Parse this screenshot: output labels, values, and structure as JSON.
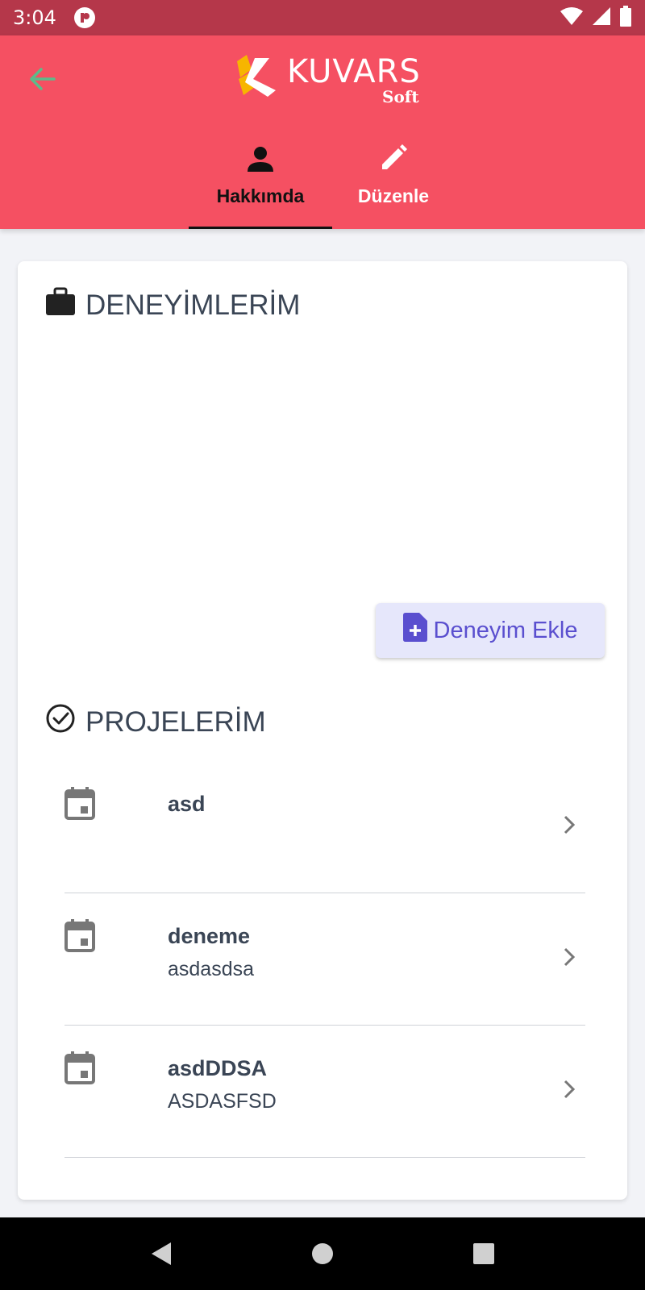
{
  "status_bar": {
    "time": "3:04",
    "icons": [
      "wifi-icon",
      "signal-icon",
      "battery-icon"
    ]
  },
  "header": {
    "back_icon": "arrow-left-icon",
    "logo_text": "KUVARS",
    "logo_sub": "Soft",
    "tabs": [
      {
        "label": "Hakkımda",
        "icon": "person-icon",
        "active": true
      },
      {
        "label": "Düzenle",
        "icon": "pencil-icon",
        "active": false
      }
    ]
  },
  "experiences": {
    "title": "DENEYİMLERİM",
    "icon": "briefcase-icon",
    "add_button_label": "Deneyim Ekle",
    "add_button_icon": "file-plus-icon"
  },
  "projects": {
    "title": "PROJELERİM",
    "icon": "check-circle-icon",
    "items": [
      {
        "title": "asd",
        "subtitle": ""
      },
      {
        "title": "deneme",
        "subtitle": "asdasdsa"
      },
      {
        "title": "asdDDSA",
        "subtitle": "ASDASFSD"
      }
    ]
  },
  "colors": {
    "status_bar": "#b5374a",
    "header": "#f55062",
    "accent": "#5a4fcf",
    "button_bg": "#e6e7fb",
    "text": "#3a4555",
    "back_arrow": "#5dbb8a"
  }
}
